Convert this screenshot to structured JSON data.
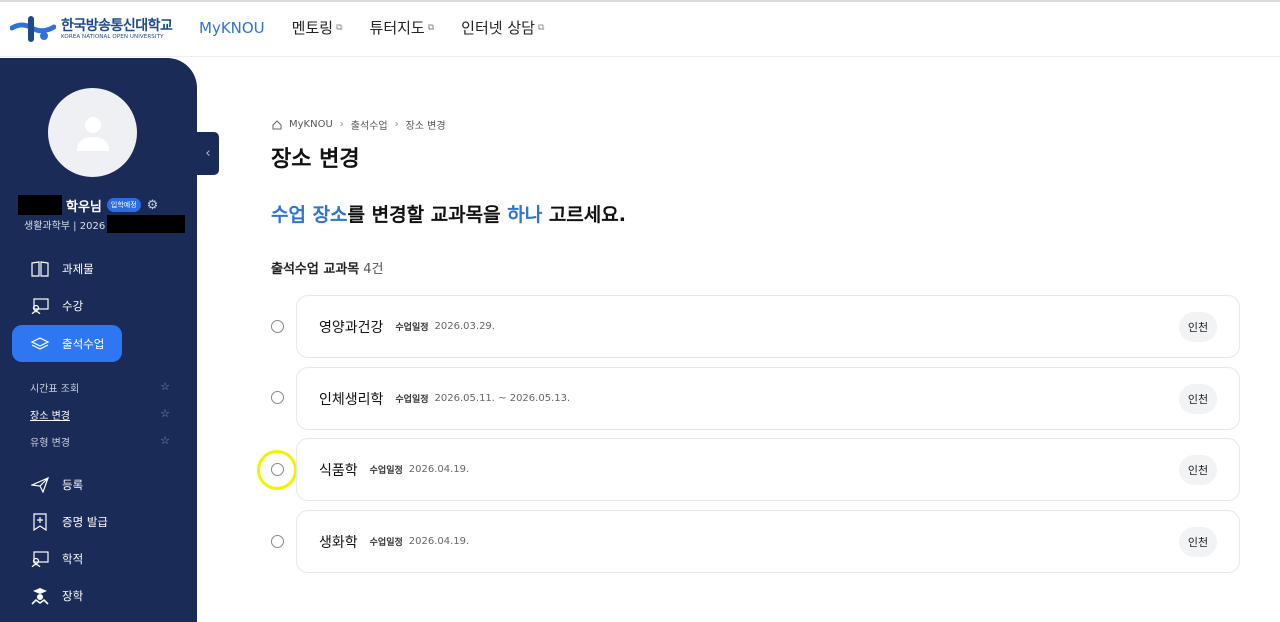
{
  "logo": {
    "kr": "한국방송통신대학교",
    "en": "KOREA NATIONAL OPEN UNIVERSITY"
  },
  "nav": [
    {
      "label": "MyKNOU",
      "active": true,
      "external": false
    },
    {
      "label": "멘토링",
      "active": false,
      "external": true
    },
    {
      "label": "튜터지도",
      "active": false,
      "external": true
    },
    {
      "label": "인터넷 상담",
      "active": false,
      "external": true
    }
  ],
  "sidebar": {
    "user_name": "학우님",
    "badge": "입학예정",
    "dept": "생활과학부 | 2026",
    "collapse_icon": "chevron-left-icon",
    "menu": [
      {
        "label": "과제물",
        "icon": "book-icon"
      },
      {
        "label": "수강",
        "icon": "lecture-icon"
      },
      {
        "label": "출석수업",
        "icon": "attendance-icon",
        "active": true
      },
      {
        "label": "등록",
        "icon": "paper-plane-icon"
      },
      {
        "label": "증명 발급",
        "icon": "certificate-icon"
      },
      {
        "label": "학적",
        "icon": "record-icon"
      },
      {
        "label": "장학",
        "icon": "scholarship-icon"
      }
    ],
    "submenu": [
      {
        "label": "시간표 조회"
      },
      {
        "label": "장소 변경",
        "current": true
      },
      {
        "label": "유형 변경"
      }
    ]
  },
  "breadcrumb": [
    "MyKNOU",
    "출석수업",
    "장소 변경"
  ],
  "page_title": "장소 변경",
  "instruction": {
    "p1": "수업 장소",
    "p2": "를 변경할 교과목을 ",
    "p3": "하나",
    "p4": " 고르세요."
  },
  "list": {
    "title": "출석수업 교과목",
    "count": "4건",
    "schedule_label": "수업일정",
    "courses": [
      {
        "name": "영양과건강",
        "date": "2026.03.29.",
        "location": "인천"
      },
      {
        "name": "인체생리학",
        "date": "2026.05.11. ~ 2026.05.13.",
        "location": "인천"
      },
      {
        "name": "식품학",
        "date": "2026.04.19.",
        "location": "인천"
      },
      {
        "name": "생화학",
        "date": "2026.04.19.",
        "location": "인천"
      }
    ]
  },
  "colors": {
    "primary": "#2e73d8",
    "sidebar": "#1b2b57",
    "active_menu": "#2f77f2",
    "highlight": "#f3f300"
  }
}
